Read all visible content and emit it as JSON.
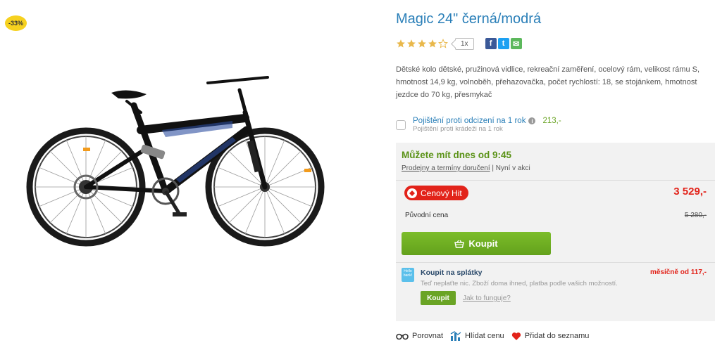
{
  "badge": {
    "discount": "-33%"
  },
  "product": {
    "title": "Magic 24\" černá/modrá",
    "rating": 4,
    "review_count": "1x",
    "description": "Dětské kolo dětské, pružinová vidlice, rekreační zaměření, ocelový rám, velikost rámu S, hmotnost 14,9 kg, volnoběh, přehazovačka, počet rychlostí: 18, se stojánkem, hmotnost jezdce do 70 kg, přesmykač"
  },
  "share": {
    "facebook": "f",
    "twitter": "t",
    "email": "✉"
  },
  "insurance": {
    "label": "Pojištění proti odcizení na 1 rok",
    "price": "213,-",
    "sub": "Pojištění proti krádeži na 1 rok"
  },
  "availability": {
    "title": "Můžete mít dnes od 9:45",
    "link": "Prodejny a termíny doručení",
    "separator": " | ",
    "note": "Nyní v akci"
  },
  "pricing": {
    "hit_label": "Cenový Hit",
    "price": "3 529,-",
    "original_label": "Původní cena",
    "original_price": "5 280,-"
  },
  "buy": {
    "label": "Koupit"
  },
  "installment": {
    "logo_text": "Hello bank!",
    "title": "Koupit na splátky",
    "monthly": "měsíčně od 117,-",
    "sub": "Teď neplaťte nic. Zboží doma ihned, platba podle vašich možností.",
    "button": "Koupit",
    "link": "Jak to funguje?"
  },
  "actions": {
    "compare": "Porovnat",
    "watch": "Hlídat cenu",
    "wishlist": "Přidat do seznamu"
  },
  "colors": {
    "accent_blue": "#2a7fb8",
    "green": "#6aa425",
    "red": "#e2231a",
    "badge_yellow": "#f6d11f"
  }
}
